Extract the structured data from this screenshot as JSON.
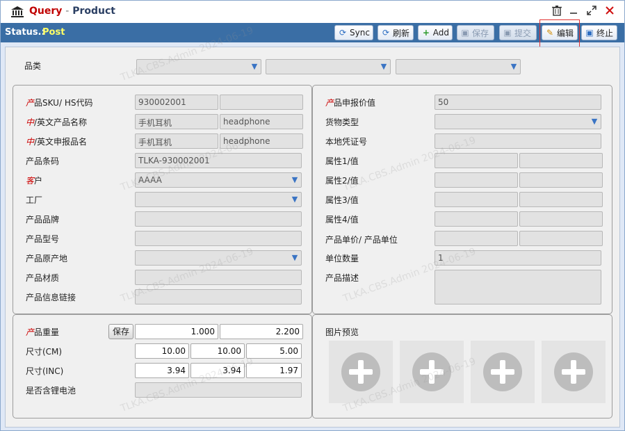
{
  "window": {
    "title_prefix": "Query",
    "title_sep": "-",
    "title_name": "Product"
  },
  "status": {
    "label": "Status.:",
    "value": "Post"
  },
  "toolbar": {
    "sync": "Sync",
    "refresh": "刷新",
    "add": "Add",
    "save": "保存",
    "submit": "提交",
    "edit": "编辑",
    "stop": "终止"
  },
  "category": {
    "label": "品类"
  },
  "left": {
    "sku_label_red": "产",
    "sku_label": "品SKU/  HS代码",
    "sku_value": "930002001",
    "hs_value": "",
    "name_label_red": "中",
    "name_label": "/英文产品名称",
    "name_cn": "手机耳机",
    "name_en": "headphone",
    "decl_label_red": "中",
    "decl_label": "/英文申报品名",
    "decl_cn": "手机耳机",
    "decl_en": "headphone",
    "barcode_label": "产品条码",
    "barcode_value": "TLKA-930002001",
    "customer_label_red": "客",
    "customer_label": "户",
    "customer_value": "AAAA",
    "factory_label": "工厂",
    "brand_label": "产品品牌",
    "model_label": "产品型号",
    "origin_label": "产品原产地",
    "material_label": "产品材质",
    "link_label": "产品信息链接"
  },
  "right": {
    "declared_label_red": "产",
    "declared_label": "品申报价值",
    "declared_value": "50",
    "cargo_label": "货物类型",
    "voucher_label": "本地凭证号",
    "attr1_label": "属性1/值",
    "attr2_label": "属性2/值",
    "attr3_label": "属性3/值",
    "attr4_label": "属性4/值",
    "unitprice_label": "产品单价/ 产品单位",
    "unitqty_label": "单位数量",
    "unitqty_value": "1",
    "desc_label": "产品描述"
  },
  "weight": {
    "label_red": "产",
    "label": "品重量",
    "save_button": "保存",
    "w1": "1.000",
    "w2": "2.200",
    "cm_label": "尺寸(CM)",
    "cm1": "10.00",
    "cm2": "10.00",
    "cm3": "5.00",
    "inc_label": "尺寸(INC)",
    "inc1": "3.94",
    "inc2": "3.94",
    "inc3": "1.97",
    "battery_label": "是否含锂电池"
  },
  "preview": {
    "label": "图片预览"
  },
  "watermark": "TLKA.CBS.Admin 2024-06-19"
}
